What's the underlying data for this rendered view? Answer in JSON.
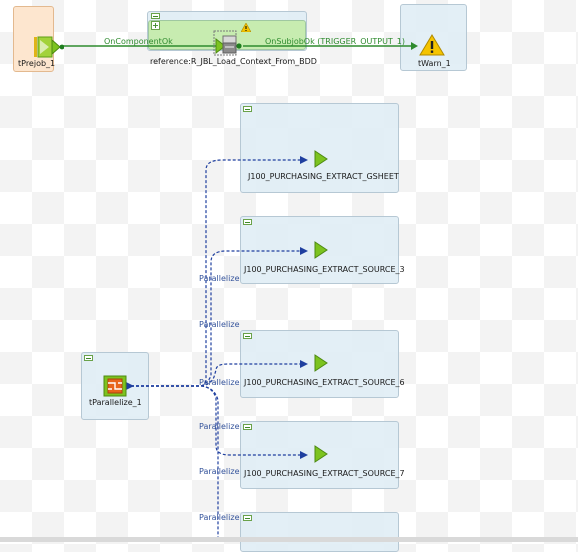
{
  "components": {
    "prejob": {
      "label": "tPrejob_1"
    },
    "runjob": {
      "label": "reference:R_JBL_Load_Context_From_BDD"
    },
    "warn": {
      "label": "tWarn_1"
    },
    "parallelize": {
      "label": "tParallelize_1"
    },
    "jobs": [
      {
        "label": "J100_PURCHASING_EXTRACT_GSHEET"
      },
      {
        "label": "J100_PURCHASING_EXTRACT_SOURCE_3"
      },
      {
        "label": "J100_PURCHASING_EXTRACT_SOURCE_6"
      },
      {
        "label": "J100_PURCHASING_EXTRACT_SOURCE_7"
      }
    ]
  },
  "links": {
    "on_component_ok": "OnComponentOk",
    "on_subjob_ok": "OnSubjobOk (TRIGGER_OUTPUT_1)",
    "parallelize": "Parallelize"
  },
  "colors": {
    "green_link": "#2e8b2e",
    "parallel_link": "#1f3f9f",
    "run_arrow": "#7cc31f",
    "warning": "#f5c400"
  },
  "icons": {
    "prejob": "prejob-icon",
    "runjob": "runjob-icon",
    "warn": "warning-icon",
    "parallelize": "parallelize-icon",
    "job": "run-job-icon"
  }
}
